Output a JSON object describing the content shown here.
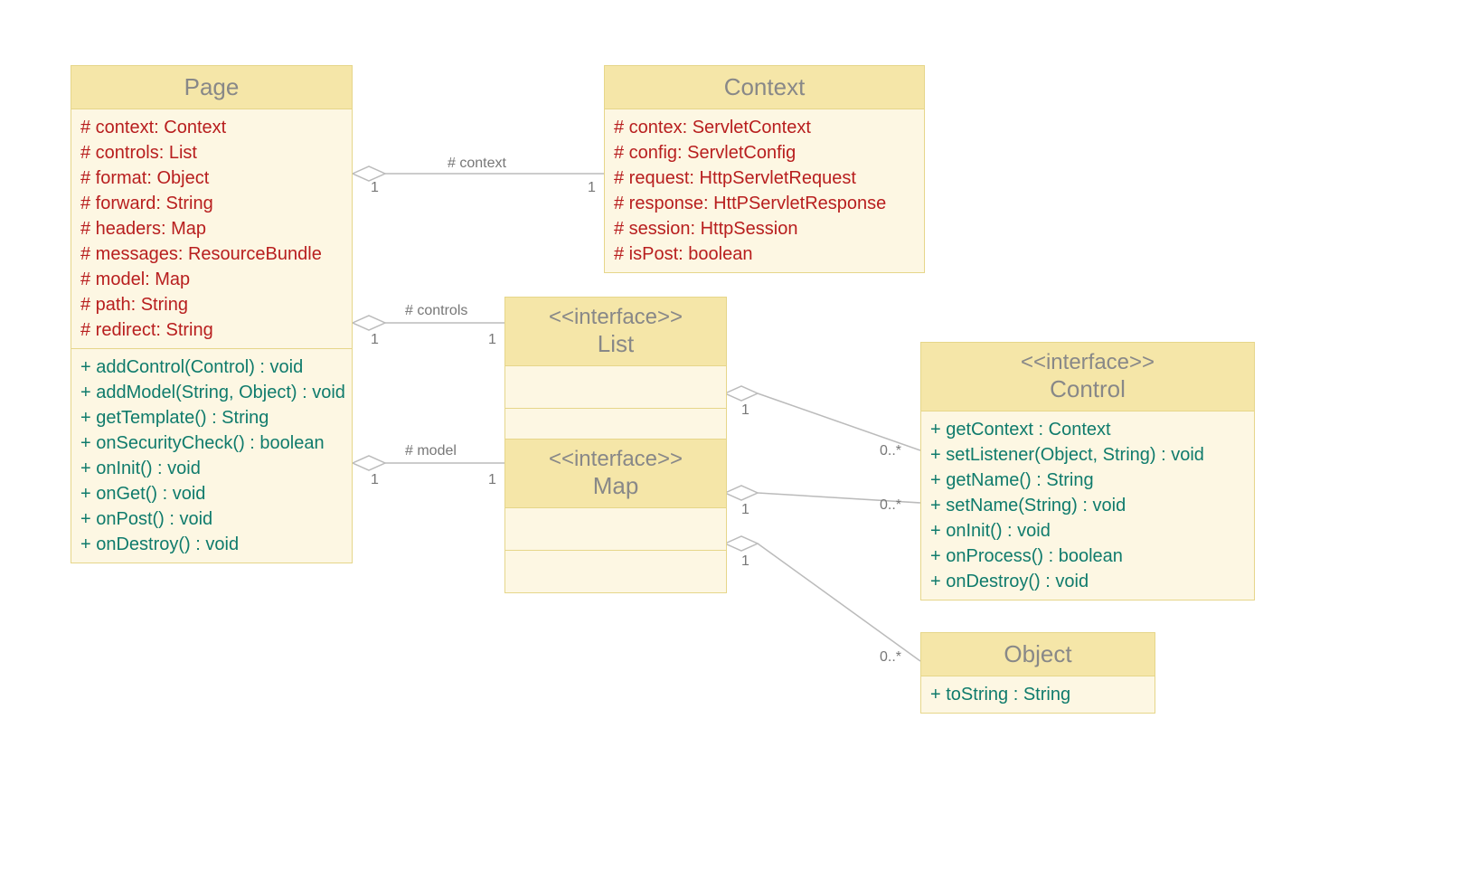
{
  "classes": {
    "page": {
      "name": "Page",
      "attrs": [
        "# context: Context",
        "# controls: List",
        "# format: Object",
        "# forward: String",
        "# headers: Map",
        "# messages: ResourceBundle",
        "# model: Map",
        "# path: String",
        "# redirect: String"
      ],
      "ops": [
        "+ addControl(Control) : void",
        "+ addModel(String, Object) : void",
        "+ getTemplate() : String",
        "+ onSecurityCheck() : boolean",
        "+ onInit() : void",
        "+ onGet() : void",
        "+ onPost() : void",
        "+ onDestroy() : void"
      ]
    },
    "context": {
      "name": "Context",
      "attrs": [
        "# contex: ServletContext",
        "# config: ServletConfig",
        "# request: HttpServletRequest",
        "# response: HttPServletResponse",
        "# session: HttpSession",
        "# isPost: boolean"
      ]
    },
    "list": {
      "stereotype": "<<interface>>",
      "name": "List"
    },
    "map": {
      "stereotype": "<<interface>>",
      "name": "Map"
    },
    "control": {
      "stereotype": "<<interface>>",
      "name": "Control",
      "ops": [
        "+ getContext : Context",
        "+ setListener(Object, String) : void",
        "+ getName() : String",
        "+ setName(String) : void",
        "+ onInit() : void",
        "+ onProcess() : boolean",
        "+ onDestroy() : void"
      ]
    },
    "object": {
      "name": "Object",
      "ops": [
        "+ toString : String"
      ]
    }
  },
  "labels": {
    "contextRole": "# context",
    "controlsRole": "# controls",
    "modelRole": "# model",
    "one": "1",
    "zeroMany": "0..*"
  }
}
